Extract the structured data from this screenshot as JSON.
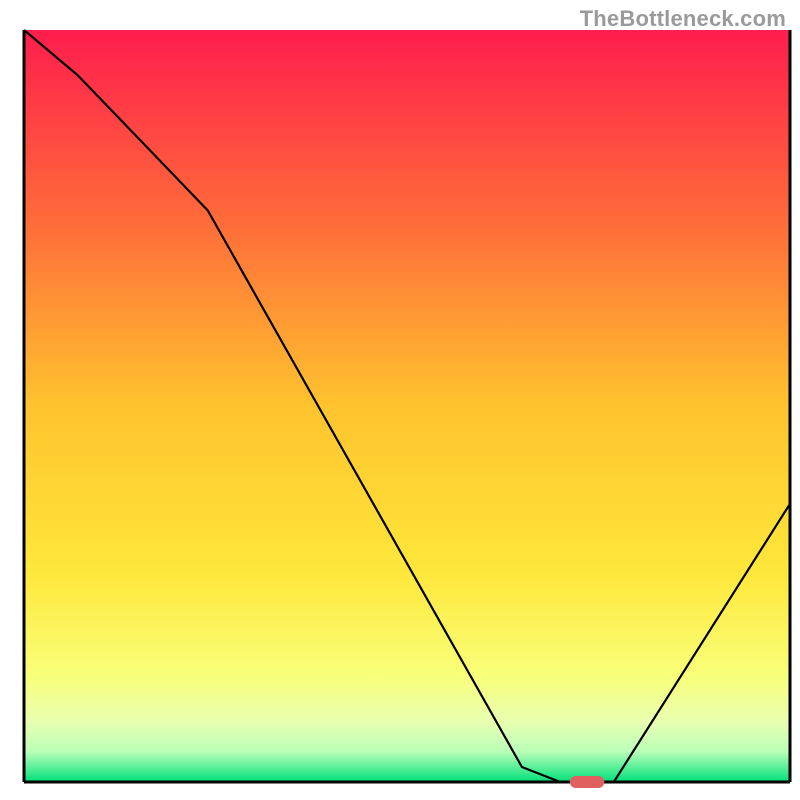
{
  "watermark": "TheBottleneck.com",
  "chart_data": {
    "type": "line",
    "title": "",
    "xlabel": "",
    "ylabel": "",
    "xlim": [
      0,
      100
    ],
    "ylim": [
      0,
      100
    ],
    "grid": false,
    "legend": false,
    "background_gradient": {
      "direction": "vertical",
      "stops": [
        {
          "pos": 0.0,
          "color": "#ff1d4d"
        },
        {
          "pos": 0.25,
          "color": "#ff6a3a"
        },
        {
          "pos": 0.5,
          "color": "#ffc32e"
        },
        {
          "pos": 0.72,
          "color": "#ffe73a"
        },
        {
          "pos": 0.86,
          "color": "#f8ff7a"
        },
        {
          "pos": 0.92,
          "color": "#eaffb0"
        },
        {
          "pos": 0.96,
          "color": "#b8ffb8"
        },
        {
          "pos": 1.0,
          "color": "#00e07a"
        }
      ]
    },
    "series": [
      {
        "name": "bottleneck-curve",
        "color": "#000000",
        "x": [
          0,
          7,
          24,
          65,
          70,
          77,
          100
        ],
        "y": [
          100,
          94,
          76,
          2,
          0,
          0,
          37
        ]
      }
    ],
    "marker": {
      "name": "optimal-point",
      "shape": "pill",
      "color": "#e06060",
      "x_center": 73.5,
      "y": 0,
      "width_pct": 4.5,
      "height_pct": 1.6
    },
    "axes_box": {
      "stroke": "#000000",
      "left": true,
      "right": true,
      "bottom": true,
      "top": false,
      "thickness_px": 3
    }
  }
}
